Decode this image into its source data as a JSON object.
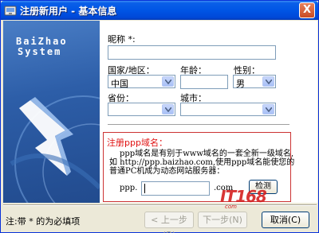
{
  "window": {
    "title": "注册新用户 - 基本信息",
    "close_label": "X"
  },
  "banner": {
    "logo_line1": "BaiZhao",
    "logo_line2": "System"
  },
  "form": {
    "nickname_label": "昵称",
    "required_mark": "*:",
    "country_label": "国家/地区：",
    "country_value": "中国",
    "age_label": "年龄：",
    "age_value": "",
    "gender_label": "性别：",
    "gender_value": "男",
    "province_label": "省份：",
    "province_value": "",
    "city_label": "城市：",
    "city_value": ""
  },
  "ppp": {
    "title": "注册ppp域名：",
    "desc_line1": "ppp域名是有别于www域名的一套全新一级域名,",
    "desc_line2": "如 http://ppp.baizhao.com,使用ppp域名能使您的",
    "desc_line3": "普通PC机成为动态网站服务器：",
    "prefix": "ppp.",
    "suffix": ".com",
    "check_button": "检测"
  },
  "footer": {
    "note": "注:带 * 的为必填项",
    "prev_button": "< 上一步(B)",
    "next_button": "下一步(N) >",
    "cancel_button": "取消(C)"
  },
  "watermark": {
    "main": "IT168",
    "sub": "com"
  },
  "colors": {
    "titlebar": "#0055e5",
    "required_text": "#e01010",
    "ppp_border": "#cc3333"
  }
}
